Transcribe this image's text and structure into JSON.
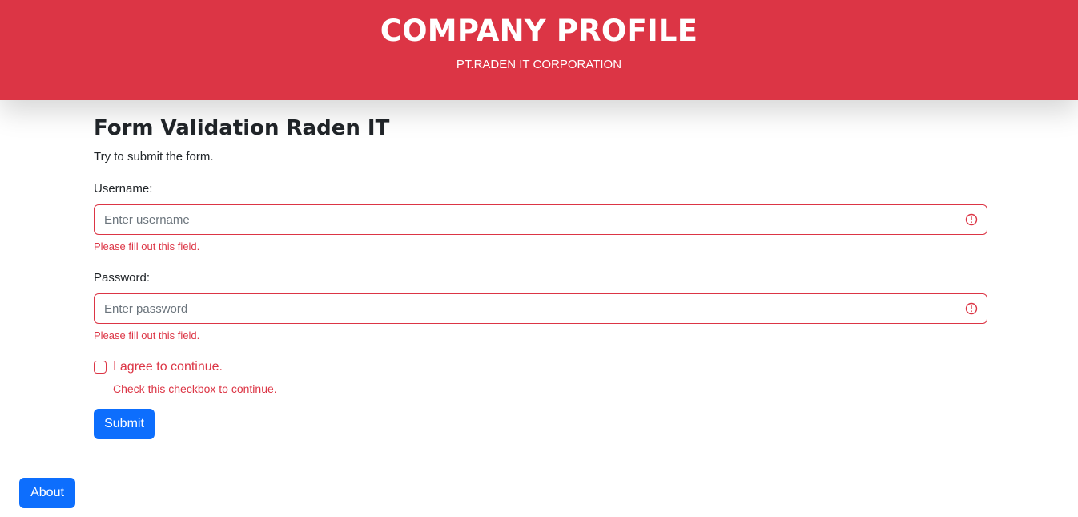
{
  "header": {
    "title": "COMPANY PROFILE",
    "subtitle": "PT.RADEN IT CORPORATION"
  },
  "form": {
    "title": "Form Validation Raden IT",
    "description": "Try to submit the form.",
    "username": {
      "label": "Username:",
      "placeholder": "Enter username",
      "value": "",
      "feedback": "Please fill out this field."
    },
    "password": {
      "label": "Password:",
      "placeholder": "Enter password",
      "value": "",
      "feedback": "Please fill out this field."
    },
    "agree": {
      "label": "I agree to continue.",
      "checked": false,
      "feedback": "Check this checkbox to continue."
    },
    "submit_label": "Submit"
  },
  "about_label": "About",
  "colors": {
    "danger": "#dc3545",
    "primary": "#0d6efd",
    "text": "#212529",
    "placeholder": "#6c757d"
  },
  "icons": {
    "invalid": "exclamation-circle-icon"
  }
}
